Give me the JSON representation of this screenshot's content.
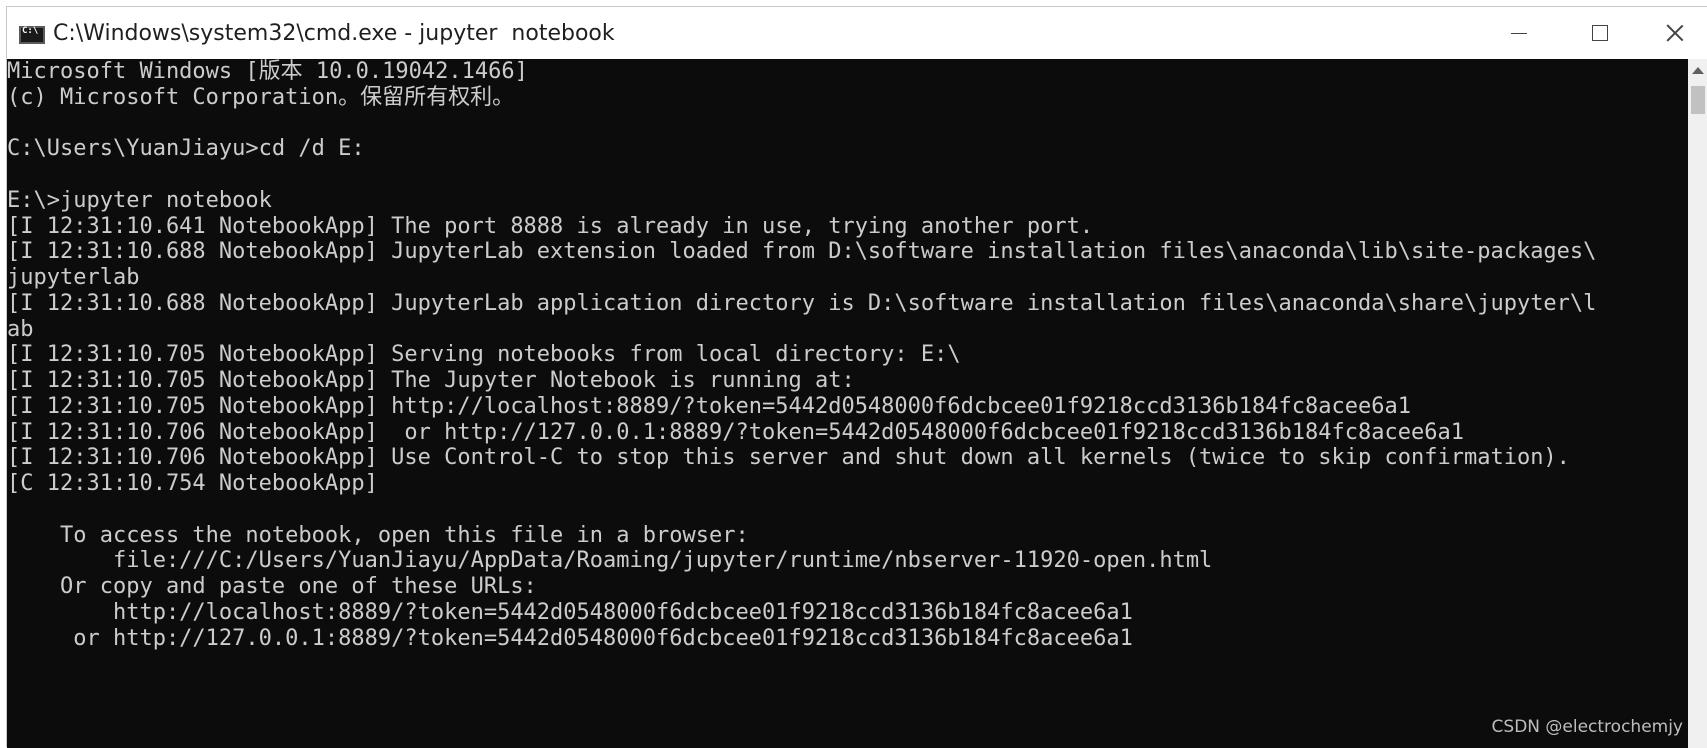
{
  "window": {
    "title": "C:\\Windows\\system32\\cmd.exe - jupyter  notebook",
    "icon": "cmd-icon",
    "controls": {
      "minimize": "minimize-icon",
      "maximize": "maximize-icon",
      "close": "close-icon"
    }
  },
  "console": {
    "background": "#0c0c0c",
    "foreground": "#cccccc",
    "lines": [
      "Microsoft Windows [版本 10.0.19042.1466]",
      "(c) Microsoft Corporation。保留所有权利。",
      "",
      "C:\\Users\\YuanJiayu>cd /d E:",
      "",
      "E:\\>jupyter notebook",
      "[I 12:31:10.641 NotebookApp] The port 8888 is already in use, trying another port.",
      "[I 12:31:10.688 NotebookApp] JupyterLab extension loaded from D:\\software installation files\\anaconda\\lib\\site-packages\\",
      "jupyterlab",
      "[I 12:31:10.688 NotebookApp] JupyterLab application directory is D:\\software installation files\\anaconda\\share\\jupyter\\l",
      "ab",
      "[I 12:31:10.705 NotebookApp] Serving notebooks from local directory: E:\\",
      "[I 12:31:10.705 NotebookApp] The Jupyter Notebook is running at:",
      "[I 12:31:10.705 NotebookApp] http://localhost:8889/?token=5442d0548000f6dcbcee01f9218ccd3136b184fc8acee6a1",
      "[I 12:31:10.706 NotebookApp]  or http://127.0.0.1:8889/?token=5442d0548000f6dcbcee01f9218ccd3136b184fc8acee6a1",
      "[I 12:31:10.706 NotebookApp] Use Control-C to stop this server and shut down all kernels (twice to skip confirmation).",
      "[C 12:31:10.754 NotebookApp]",
      "",
      "    To access the notebook, open this file in a browser:",
      "        file:///C:/Users/YuanJiayu/AppData/Roaming/jupyter/runtime/nbserver-11920-open.html",
      "    Or copy and paste one of these URLs:",
      "        http://localhost:8889/?token=5442d0548000f6dcbcee01f9218ccd3136b184fc8acee6a1",
      "     or http://127.0.0.1:8889/?token=5442d0548000f6dcbcee01f9218ccd3136b184fc8acee6a1"
    ]
  },
  "watermark": "CSDN @electrochemjy"
}
